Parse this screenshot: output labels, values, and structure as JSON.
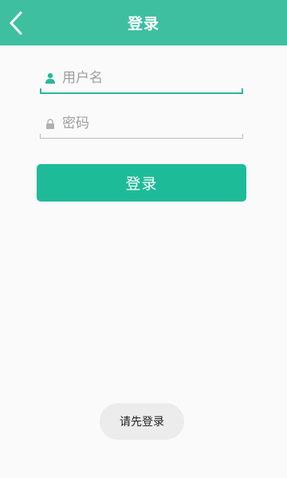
{
  "header": {
    "title": "登录",
    "back_icon": "chevron-left-icon"
  },
  "form": {
    "username": {
      "placeholder": "用户名",
      "value": "",
      "icon": "user-icon"
    },
    "password": {
      "placeholder": "密码",
      "value": "",
      "icon": "lock-icon"
    },
    "submit_label": "登录"
  },
  "toast": {
    "message": "请先登录"
  },
  "colors": {
    "header_bg": "#3dbfa0",
    "accent": "#1dbb98",
    "background": "#fafafa",
    "toast_bg": "#ececec"
  }
}
